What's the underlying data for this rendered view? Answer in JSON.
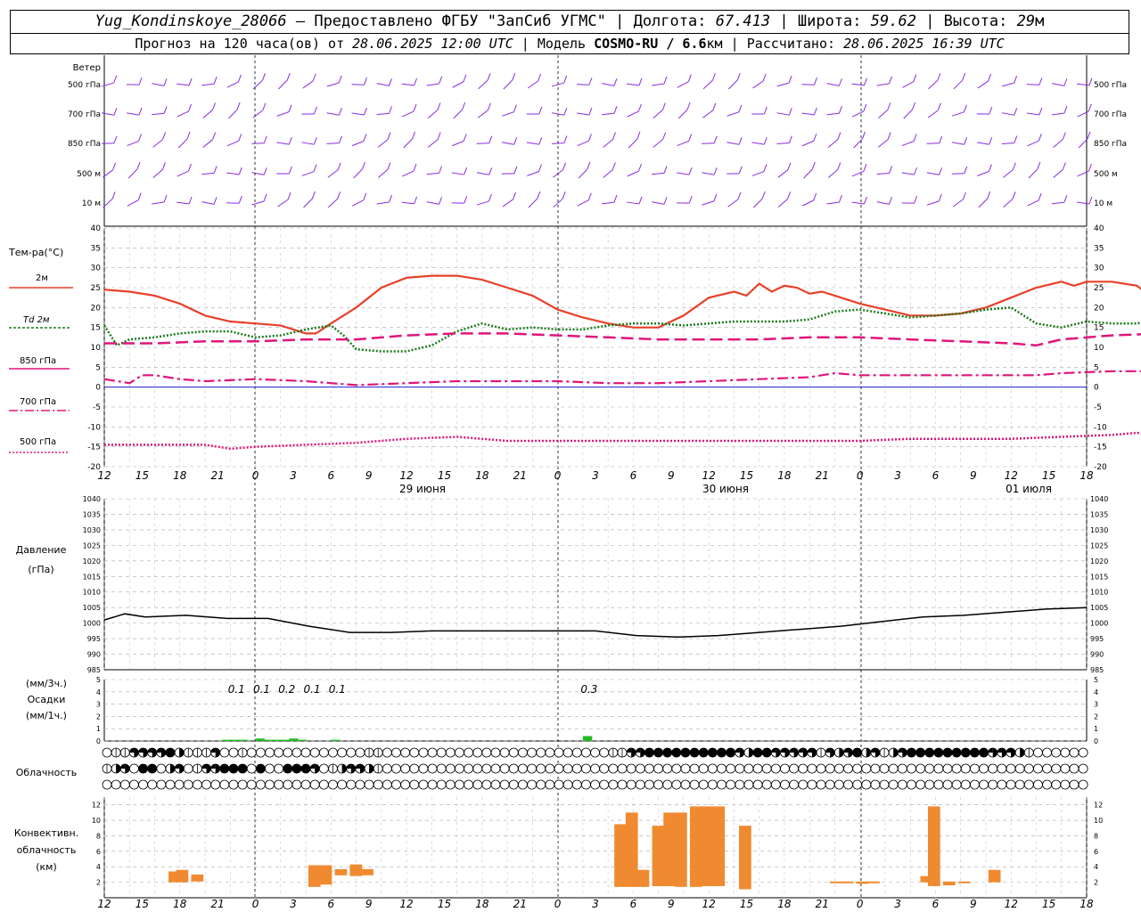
{
  "header": {
    "station": "Yug_Kondinskoye_28066",
    "provider": "– Предоставлено ФГБУ \"ЗапСиб УГМС\"",
    "lon_label": "Долгота:",
    "lon_value": "67.413",
    "lat_label": "Широта:",
    "lat_value": "59.62",
    "alt_label": "Высота:",
    "alt_value": "29",
    "alt_unit": "м",
    "forecast_label": "Прогноз на 120 часа(ов) от",
    "forecast_time": "28.06.2025 12:00 UTC",
    "model_label": "Модель",
    "model_name": "COSMO-RU / 6.6",
    "model_unit": "км",
    "calc_label": "Рассчитано:",
    "calc_time": "28.06.2025 16:39 UTC"
  },
  "labels": {
    "wind": "Ветер",
    "wind_levels": [
      "500 гПа",
      "700 гПа",
      "850 гПа",
      "500 м",
      "10 м"
    ],
    "temp_title": "Тем-ра(°С)",
    "temp_2m": "2м",
    "td_prefix": "Td",
    "td_suffix": "2м",
    "t850": "850 гПа",
    "t700": "700 гПа",
    "t500": "500 гПа",
    "pressure": "Давление",
    "pressure_unit": "(гПа)",
    "precip_unit1": "(мм/3ч.)",
    "precip": "Осадки",
    "precip_unit2": "(мм/1ч.)",
    "cloud": "Облачность",
    "conv1": "Конвективн.",
    "conv2": "облачность",
    "conv3": "(км)"
  },
  "colors": {
    "wind": "#8a2be2",
    "t2m": "#e8402a",
    "td": "#1a7a1a",
    "tlev": "#e0157a",
    "zero": "#0000cc",
    "precip": "#22bb22",
    "conv": "#f08a30",
    "pressure": "#000000"
  },
  "chart_data": {
    "type": "line",
    "x_axis": {
      "tick_labels": [
        "12",
        "15",
        "18",
        "21",
        "0",
        "3",
        "6",
        "9",
        "12",
        "15",
        "18",
        "21",
        "0",
        "3",
        "6",
        "9",
        "12",
        "15",
        "18",
        "21",
        "0",
        "3",
        "6",
        "9",
        "12",
        "15",
        "18"
      ],
      "day_labels": [
        "29 июня",
        "30 июня",
        "01 июля"
      ]
    },
    "temperature": {
      "ylim": [
        -20,
        40
      ],
      "yticks": [
        40,
        35,
        30,
        25,
        20,
        15,
        10,
        5,
        0,
        -5,
        -10,
        -15,
        -20
      ],
      "series": [
        {
          "name": "2м",
          "style": "solid",
          "points": [
            [
              0,
              24.5
            ],
            [
              1,
              24
            ],
            [
              2,
              23
            ],
            [
              3,
              21
            ],
            [
              4,
              18
            ],
            [
              5,
              16.5
            ],
            [
              6,
              16
            ],
            [
              7,
              15.5
            ],
            [
              8,
              13.5
            ],
            [
              8.4,
              13.5
            ],
            [
              9,
              16
            ],
            [
              10,
              20
            ],
            [
              11,
              25
            ],
            [
              12,
              27.5
            ],
            [
              13,
              28
            ],
            [
              14,
              28
            ],
            [
              15,
              27
            ],
            [
              16,
              25
            ],
            [
              17,
              23
            ],
            [
              18,
              19.5
            ],
            [
              19,
              17.5
            ],
            [
              20,
              16
            ],
            [
              21,
              15
            ],
            [
              22,
              15
            ],
            [
              23,
              18
            ],
            [
              24,
              22.5
            ],
            [
              25,
              24
            ],
            [
              25.5,
              23
            ],
            [
              26,
              26
            ],
            [
              26.5,
              24
            ],
            [
              27,
              25.5
            ],
            [
              27.5,
              25
            ],
            [
              28,
              23.5
            ],
            [
              28.5,
              24
            ],
            [
              29,
              23
            ],
            [
              30,
              21
            ],
            [
              31,
              19.5
            ],
            [
              32,
              18
            ],
            [
              33,
              18
            ],
            [
              34,
              18.5
            ],
            [
              35,
              20
            ],
            [
              36,
              22.5
            ],
            [
              37,
              25
            ],
            [
              38,
              26.5
            ],
            [
              38.5,
              25.5
            ],
            [
              39,
              26.5
            ],
            [
              40,
              26.5
            ],
            [
              41,
              25.5
            ],
            [
              41.5,
              23
            ],
            [
              42,
              20.5
            ]
          ]
        },
        {
          "name": "Td 2м",
          "style": "dotted",
          "points": [
            [
              0,
              15.5
            ],
            [
              0.5,
              10.5
            ],
            [
              1,
              12
            ],
            [
              2,
              12.5
            ],
            [
              3,
              13.5
            ],
            [
              4,
              14
            ],
            [
              5,
              14
            ],
            [
              6,
              12.5
            ],
            [
              7,
              13
            ],
            [
              8,
              14.5
            ],
            [
              9,
              15.5
            ],
            [
              9.5,
              13
            ],
            [
              10,
              9.5
            ],
            [
              11,
              9
            ],
            [
              12,
              9
            ],
            [
              13,
              10.5
            ],
            [
              14,
              14
            ],
            [
              15,
              16
            ],
            [
              16,
              14.5
            ],
            [
              17,
              15
            ],
            [
              18,
              14.5
            ],
            [
              19,
              14.5
            ],
            [
              20,
              15.5
            ],
            [
              21,
              16
            ],
            [
              22,
              16
            ],
            [
              23,
              15.5
            ],
            [
              24,
              16
            ],
            [
              25,
              16.5
            ],
            [
              26,
              16.5
            ],
            [
              27,
              16.5
            ],
            [
              28,
              17
            ],
            [
              29,
              19
            ],
            [
              30,
              19.5
            ],
            [
              31,
              18.5
            ],
            [
              32,
              17.5
            ],
            [
              33,
              18
            ],
            [
              34,
              18.5
            ],
            [
              35,
              19.5
            ],
            [
              36,
              20
            ],
            [
              37,
              16
            ],
            [
              38,
              15
            ],
            [
              39,
              16.5
            ],
            [
              40,
              16
            ],
            [
              41,
              16
            ],
            [
              42,
              17.5
            ]
          ]
        },
        {
          "name": "850 гПа",
          "style": "longdash",
          "points": [
            [
              0,
              11
            ],
            [
              2,
              11
            ],
            [
              4,
              11.5
            ],
            [
              6,
              11.5
            ],
            [
              8,
              12
            ],
            [
              10,
              12
            ],
            [
              12,
              13
            ],
            [
              14,
              13.5
            ],
            [
              16,
              13.5
            ],
            [
              18,
              13
            ],
            [
              20,
              12.5
            ],
            [
              22,
              12
            ],
            [
              24,
              12
            ],
            [
              26,
              12
            ],
            [
              28,
              12.5
            ],
            [
              30,
              12.5
            ],
            [
              32,
              12
            ],
            [
              34,
              11.5
            ],
            [
              36,
              11
            ],
            [
              37,
              10.5
            ],
            [
              38,
              12
            ],
            [
              40,
              13
            ],
            [
              42,
              13.5
            ]
          ]
        },
        {
          "name": "700 гПа",
          "style": "dashdot",
          "points": [
            [
              0,
              2
            ],
            [
              1,
              1
            ],
            [
              1.5,
              3
            ],
            [
              2,
              3
            ],
            [
              3,
              2
            ],
            [
              4,
              1.5
            ],
            [
              6,
              2
            ],
            [
              8,
              1.5
            ],
            [
              9,
              1
            ],
            [
              10,
              0.5
            ],
            [
              12,
              1
            ],
            [
              14,
              1.5
            ],
            [
              16,
              1.5
            ],
            [
              18,
              1.5
            ],
            [
              20,
              1
            ],
            [
              22,
              1
            ],
            [
              24,
              1.5
            ],
            [
              26,
              2
            ],
            [
              28,
              2.5
            ],
            [
              29,
              3.5
            ],
            [
              30,
              3
            ],
            [
              32,
              3
            ],
            [
              34,
              3
            ],
            [
              36,
              3
            ],
            [
              37,
              3
            ],
            [
              38,
              3.5
            ],
            [
              40,
              4
            ],
            [
              42,
              4
            ]
          ]
        },
        {
          "name": "500 гПа",
          "style": "dotted",
          "points": [
            [
              0,
              -14.5
            ],
            [
              2,
              -14.5
            ],
            [
              4,
              -14.5
            ],
            [
              5,
              -15.5
            ],
            [
              6,
              -15
            ],
            [
              8,
              -14.5
            ],
            [
              10,
              -14
            ],
            [
              12,
              -13
            ],
            [
              14,
              -12.5
            ],
            [
              16,
              -13.5
            ],
            [
              18,
              -13.5
            ],
            [
              20,
              -13.5
            ],
            [
              22,
              -13.5
            ],
            [
              24,
              -13.5
            ],
            [
              26,
              -13.5
            ],
            [
              28,
              -13.5
            ],
            [
              30,
              -13.5
            ],
            [
              32,
              -13
            ],
            [
              34,
              -13
            ],
            [
              36,
              -13
            ],
            [
              38,
              -12.5
            ],
            [
              40,
              -12
            ],
            [
              41,
              -11.5
            ],
            [
              42,
              -12
            ]
          ]
        }
      ]
    },
    "pressure": {
      "ylim": [
        985,
        1040
      ],
      "yticks": [
        1040,
        1035,
        1030,
        1025,
        1020,
        1015,
        1010,
        1005,
        1000,
        995,
        990,
        985
      ],
      "points": [
        [
          0,
          1001
        ],
        [
          1,
          1003
        ],
        [
          2,
          1002
        ],
        [
          4,
          1002.5
        ],
        [
          6,
          1001.5
        ],
        [
          8,
          1001.5
        ],
        [
          10,
          999
        ],
        [
          12,
          997
        ],
        [
          14,
          997
        ],
        [
          16,
          997.5
        ],
        [
          18,
          997.5
        ],
        [
          20,
          997.5
        ],
        [
          22,
          997.5
        ],
        [
          24,
          997.5
        ],
        [
          26,
          996
        ],
        [
          28,
          995.5
        ],
        [
          30,
          996
        ],
        [
          32,
          997
        ],
        [
          34,
          998
        ],
        [
          36,
          999
        ],
        [
          38,
          1000.5
        ],
        [
          40,
          1002
        ],
        [
          42,
          1002.5
        ],
        [
          44,
          1003.5
        ],
        [
          46,
          1004.5
        ],
        [
          48,
          1005
        ]
      ]
    },
    "precip": {
      "ylim": [
        0,
        5
      ],
      "yticks": [
        5,
        4,
        3,
        2,
        1,
        0
      ],
      "labels": [
        {
          "x": 15,
          "text": "0.1"
        },
        {
          "x": 18,
          "text": "0.1"
        },
        {
          "x": 21,
          "text": "0.2"
        },
        {
          "x": 24,
          "text": "0.1"
        },
        {
          "x": 27,
          "text": "0.1"
        },
        {
          "x": 57,
          "text": "0.3"
        }
      ],
      "bars": [
        [
          14,
          0.1
        ],
        [
          15,
          0.1
        ],
        [
          16,
          0.1
        ],
        [
          18,
          0.2
        ],
        [
          19,
          0.1
        ],
        [
          20,
          0.1
        ],
        [
          21,
          0.1
        ],
        [
          22,
          0.2
        ],
        [
          23,
          0.1
        ],
        [
          27,
          0.1
        ],
        [
          57,
          0.4
        ]
      ]
    },
    "cloud": {
      "rows": [
        "0113333421113001000000000000011000000000000000000000000011334444444444324433333132342312344444444433321000000",
        "1230440230133444040044430123321000000000000000000000000000000000000000000000000000000000000000000000000000000",
        "0000000000000000000000000000000000000000000000000000000000000000000000000000000000000000000000000000000000000"
      ]
    },
    "convective": {
      "ylim": [
        0,
        13
      ],
      "yticks": [
        12,
        10,
        8,
        6,
        4,
        2
      ],
      "bars": [
        [
          1.7,
          2.0,
          3.4
        ],
        [
          1.9,
          2.0,
          3.6
        ],
        [
          2.3,
          2.1,
          3.0
        ],
        [
          5.4,
          1.4,
          4.2
        ],
        [
          5.7,
          1.7,
          4.2
        ],
        [
          6.1,
          2.9,
          3.7
        ],
        [
          6.5,
          2.8,
          4.3
        ],
        [
          6.8,
          2.9,
          3.7
        ],
        [
          13.5,
          1.4,
          9.5
        ],
        [
          13.8,
          1.4,
          11.0
        ],
        [
          14.1,
          1.4,
          3.6
        ],
        [
          14.5,
          1.5,
          9.3
        ],
        [
          14.8,
          1.5,
          11.0
        ],
        [
          15.1,
          1.4,
          11.0
        ],
        [
          15.5,
          1.4,
          11.8
        ],
        [
          15.8,
          1.5,
          11.8
        ],
        [
          16.1,
          1.5,
          11.8
        ],
        [
          16.8,
          1.1,
          9.3
        ],
        [
          19.2,
          1.9,
          2.1
        ],
        [
          19.5,
          2.0,
          2.1
        ],
        [
          19.9,
          1.8,
          2.1
        ],
        [
          20.2,
          1.9,
          2.1
        ],
        [
          21.6,
          2.0,
          2.8
        ],
        [
          21.8,
          1.5,
          11.8
        ],
        [
          22.2,
          1.6,
          2.1
        ],
        [
          22.6,
          2.0,
          2.1
        ],
        [
          23.4,
          2.0,
          3.6
        ]
      ]
    }
  }
}
